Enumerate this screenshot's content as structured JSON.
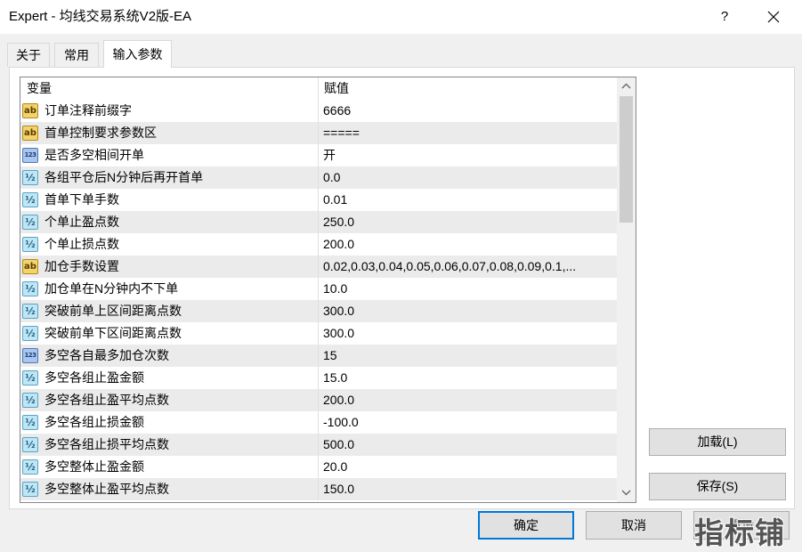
{
  "window": {
    "title": "Expert - 均线交易系统V2版-EA",
    "help": "?",
    "close_icon": "close-icon"
  },
  "tabs": [
    {
      "label": "关于",
      "active": false
    },
    {
      "label": "常用",
      "active": false
    },
    {
      "label": "输入参数",
      "active": true
    }
  ],
  "icon_glyphs": {
    "string-icon": "ab",
    "integer-icon": "123",
    "double-icon": "½"
  },
  "table": {
    "headers": {
      "variable": "变量",
      "value": "赋值"
    },
    "rows": [
      {
        "icon": "string-icon",
        "name": "订单注释前缀字",
        "value": "6666"
      },
      {
        "icon": "string-icon",
        "name": "首单控制要求参数区",
        "value": "====="
      },
      {
        "icon": "integer-icon",
        "name": "是否多空相间开单",
        "value": "开"
      },
      {
        "icon": "double-icon",
        "name": "各组平仓后N分钟后再开首单",
        "value": "0.0"
      },
      {
        "icon": "double-icon",
        "name": "首单下单手数",
        "value": "0.01"
      },
      {
        "icon": "double-icon",
        "name": "个单止盈点数",
        "value": "250.0"
      },
      {
        "icon": "double-icon",
        "name": "个单止损点数",
        "value": "200.0"
      },
      {
        "icon": "string-icon",
        "name": "加仓手数设置",
        "value": "0.02,0.03,0.04,0.05,0.06,0.07,0.08,0.09,0.1,..."
      },
      {
        "icon": "double-icon",
        "name": "加仓单在N分钟内不下单",
        "value": "10.0"
      },
      {
        "icon": "double-icon",
        "name": "突破前单上区间距离点数",
        "value": "300.0"
      },
      {
        "icon": "double-icon",
        "name": "突破前单下区间距离点数",
        "value": "300.0"
      },
      {
        "icon": "integer-icon",
        "name": "多空各自最多加仓次数",
        "value": "15"
      },
      {
        "icon": "double-icon",
        "name": "多空各组止盈金额",
        "value": "15.0"
      },
      {
        "icon": "double-icon",
        "name": "多空各组止盈平均点数",
        "value": "200.0"
      },
      {
        "icon": "double-icon",
        "name": "多空各组止损金额",
        "value": "-100.0"
      },
      {
        "icon": "double-icon",
        "name": "多空各组止损平均点数",
        "value": "500.0"
      },
      {
        "icon": "double-icon",
        "name": "多空整体止盈金额",
        "value": "20.0"
      },
      {
        "icon": "double-icon",
        "name": "多空整体止盈平均点数",
        "value": "150.0"
      }
    ]
  },
  "buttons": {
    "load": "加载(L)",
    "save": "保存(S)",
    "ok": "确定",
    "cancel": "取消",
    "reset": "重设"
  },
  "watermark": "指标铺",
  "colors": {
    "accent": "#0078d7",
    "row_alt": "#ebebeb",
    "button_bg": "#e1e1e1"
  }
}
